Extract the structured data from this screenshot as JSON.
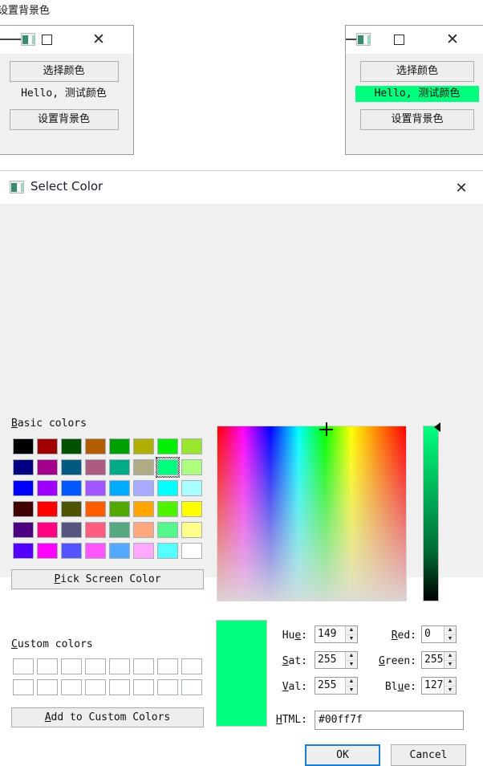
{
  "desktop": {
    "title": "设置背景色"
  },
  "windows": [
    {
      "id": "left",
      "icon": "app-icon",
      "maximize_label": "maximize",
      "close_label": "close",
      "choose_color_label": "选择颜色",
      "sample_text": "Hello, 测试颜色",
      "sample_bg": "transparent",
      "set_bg_label": "设置背景色"
    },
    {
      "id": "right",
      "icon": "app-icon",
      "maximize_label": "maximize",
      "close_label": "close",
      "choose_color_label": "选择颜色",
      "sample_text": "Hello, 测试颜色",
      "sample_bg": "#00ff7f",
      "set_bg_label": "设置背景色"
    }
  ],
  "dialog": {
    "title": "Select Color",
    "close_label": "×",
    "basic_colors_label": "Basic colors",
    "custom_colors_label": "Custom colors",
    "pick_screen_color_label": "Pick Screen Color",
    "add_custom_colors_label": "Add to Custom Colors",
    "ok_label": "OK",
    "cancel_label": "Cancel",
    "selected_index": 14,
    "basic_colors": [
      "#000000",
      "#a00000",
      "#005000",
      "#b35c00",
      "#00a000",
      "#b0ae00",
      "#00f000",
      "#9ae62e",
      "#000080",
      "#a4008c",
      "#005b80",
      "#ad5b80",
      "#00ab85",
      "#aeab85",
      "#00ff7f",
      "#aeff7f",
      "#0000ff",
      "#a000ff",
      "#0057ff",
      "#a057ff",
      "#00aaff",
      "#a8aaff",
      "#00ffff",
      "#a8ffff",
      "#400000",
      "#ff0000",
      "#4f5300",
      "#ff5c00",
      "#53a700",
      "#ffa700",
      "#4cf200",
      "#ffff00",
      "#4c007f",
      "#ff0080",
      "#555580",
      "#ff5c80",
      "#55a87f",
      "#ffa880",
      "#55f78c",
      "#ffff8c",
      "#5500ff",
      "#ff00ff",
      "#5555ff",
      "#ff55ff",
      "#55a8ff",
      "#ffa8ff",
      "#55ffff",
      "#ffffff"
    ],
    "custom_colors": [
      "#ffffff",
      "#ffffff",
      "#ffffff",
      "#ffffff",
      "#ffffff",
      "#ffffff",
      "#ffffff",
      "#ffffff",
      "#ffffff",
      "#ffffff",
      "#ffffff",
      "#ffffff",
      "#ffffff",
      "#ffffff",
      "#ffffff",
      "#ffffff"
    ],
    "preview_color": "#00ff7f",
    "fields": {
      "hue_label": "Hue:",
      "hue_value": "149",
      "sat_label": "Sat:",
      "sat_value": "255",
      "val_label": "Val:",
      "val_value": "255",
      "red_label": "Red:",
      "red_value": "0",
      "green_label": "Green:",
      "green_value": "255",
      "blue_label": "Blue:",
      "blue_value": "127",
      "html_label": "HTML:",
      "html_value": "#00ff7f"
    },
    "spin_up": "▲",
    "spin_down": "▼"
  }
}
